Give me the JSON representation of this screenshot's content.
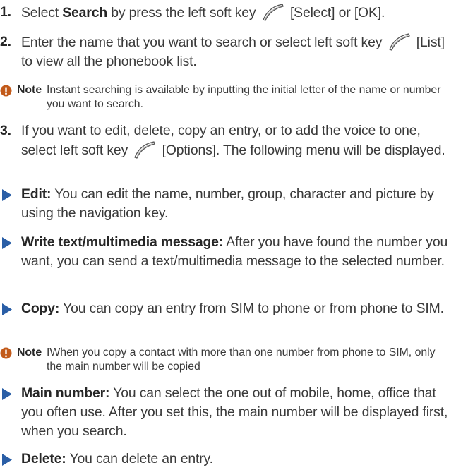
{
  "steps": [
    {
      "number": "1.",
      "pre": "Select ",
      "bold": "Search",
      "post": " by press the left soft key",
      "after_key": "[Select] or [OK]."
    },
    {
      "number": "2.",
      "pre": "Enter the name that you want to search or select left soft key",
      "after_key": "[List] to view all the phonebook list."
    },
    {
      "number": "3.",
      "pre": "If you want to edit, delete, copy an entry, or to add the voice to one, select left soft key",
      "after_key": "[Options]. The following menu will be displayed."
    }
  ],
  "notes": [
    {
      "label": "Note",
      "text": "Instant searching is available by inputting the initial letter of the name or number you want to search."
    },
    {
      "label": "Note",
      "text": "IWhen you copy a contact with more than one number from phone to SIM, only the main number will be copied"
    }
  ],
  "menu_items": [
    {
      "title": "Edit:",
      "text": " You can edit the name, number, group, character and picture by using the navigation key."
    },
    {
      "title": "Write text/multimedia message:",
      "text": " After you have found the number you want, you can send a text/multimedia message to the selected number."
    },
    {
      "title": "Copy:",
      "text": " You can copy an entry from SIM to phone or from phone to SIM."
    },
    {
      "title": "Main number:",
      "text": " You can select the one out of mobile, home, office that you often use. After you set this, the main number will be displayed first, when you search."
    },
    {
      "title": "Delete:",
      "text": " You can delete an entry."
    }
  ],
  "icons": {
    "soft_key": "left-soft-key-icon",
    "note": "note-info-icon",
    "bullet": "triangle-bullet-icon"
  },
  "colors": {
    "text": "#3a3a3a",
    "heading": "#262626",
    "bullet_blue": "#2a5ea6",
    "note_orange": "#c25a1a"
  }
}
